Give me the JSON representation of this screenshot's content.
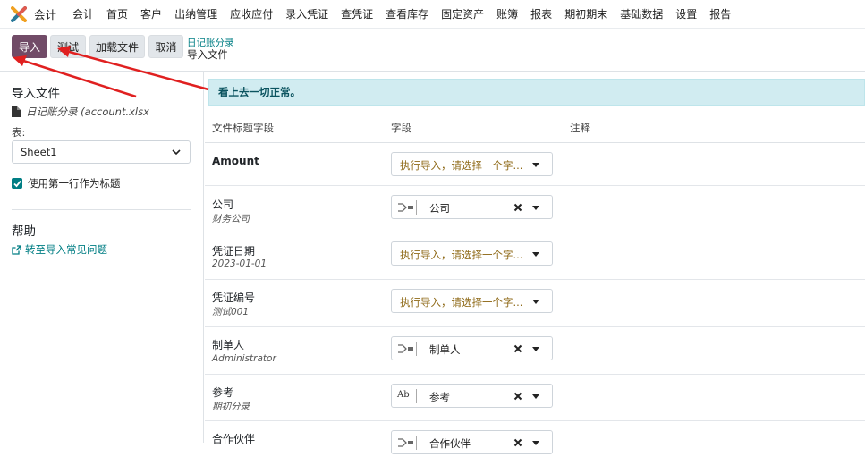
{
  "app": {
    "name": "会计"
  },
  "menu": [
    "会计",
    "首页",
    "客户",
    "出纳管理",
    "应收应付",
    "录入凭证",
    "查凭证",
    "查看库存",
    "固定资产",
    "账簿",
    "报表",
    "期初期末",
    "基础数据",
    "设置",
    "报告"
  ],
  "actions": {
    "import_label": "导入",
    "test_label": "测试",
    "load_file_label": "加载文件",
    "cancel_label": "取消"
  },
  "breadcrumb": {
    "parent": "日记账分录",
    "current": "导入文件"
  },
  "sidebar": {
    "title": "导入文件",
    "file_name": "日记账分录 (account.xlsx",
    "sheet_label": "表:",
    "sheet_value": "Sheet1",
    "header_checkbox_label": "使用第一行作为标题",
    "help_title": "帮助",
    "help_link": "转至导入常见问题"
  },
  "alert": {
    "message": "看上去一切正常。"
  },
  "table": {
    "headers": {
      "file_column": "文件标题字段",
      "field": "字段",
      "comment": "注释"
    },
    "rows": [
      {
        "title": "Amount",
        "subtitle": "",
        "placeholder": "执行导入，请选择一个字...",
        "value": ""
      },
      {
        "title": "公司",
        "subtitle": "财务公司",
        "placeholder": "",
        "value": "公司",
        "icon": "relation-icon"
      },
      {
        "title": "凭证日期",
        "subtitle": "2023-01-01",
        "placeholder": "执行导入，请选择一个字...",
        "value": ""
      },
      {
        "title": "凭证编号",
        "subtitle": "测试001",
        "placeholder": "执行导入，请选择一个字...",
        "value": ""
      },
      {
        "title": "制单人",
        "subtitle": "Administrator",
        "placeholder": "",
        "value": "制单人",
        "icon": "relation-icon"
      },
      {
        "title": "参考",
        "subtitle": "期初分录",
        "placeholder": "",
        "value": "参考",
        "icon": "text-field-icon",
        "icon_text": "Ab"
      },
      {
        "title": "合作伙伴",
        "subtitle": "",
        "placeholder": "",
        "value": "合作伙伴",
        "icon": "relation-icon"
      }
    ]
  },
  "colors": {
    "primary": "#714b67",
    "link": "#017e84",
    "alert_bg": "#d1ecf1",
    "alert_text": "#0c5460",
    "arrow": "#e02020"
  }
}
